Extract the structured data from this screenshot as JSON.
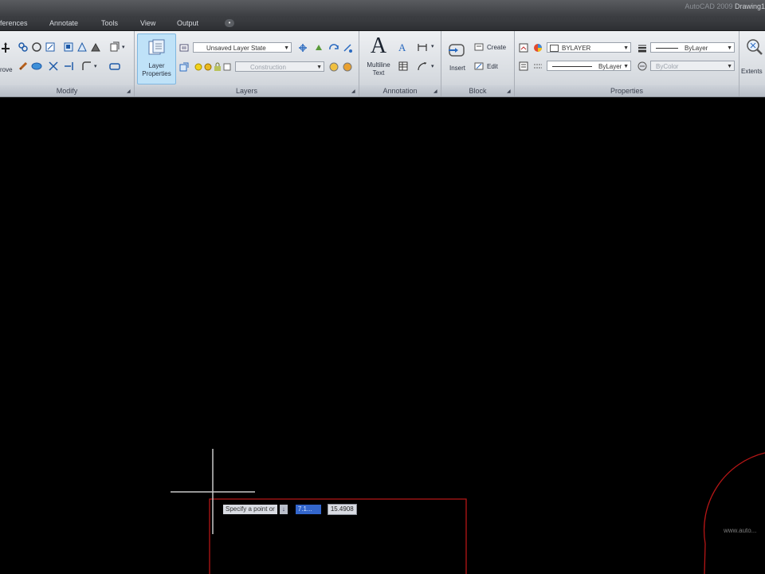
{
  "window": {
    "app_title_prefix": "AutoCAD 2009",
    "app_title_doc": "Drawing1"
  },
  "tabs": [
    "ferences",
    "Annotate",
    "Tools",
    "View",
    "Output"
  ],
  "ribbon": {
    "modify": {
      "label": "Modify",
      "partial_button_label": "rove"
    },
    "layers": {
      "label": "Layers",
      "layer_properties_label": "Layer Properties",
      "layer_state_value": "Unsaved Layer State",
      "current_layer_value": "Construction"
    },
    "annotation": {
      "label": "Annotation",
      "multiline_text_label": "Multiline Text",
      "big_letter": "A"
    },
    "block": {
      "label": "Block",
      "insert_label": "Insert",
      "create_label": "Create",
      "edit_label": "Edit"
    },
    "properties": {
      "label": "Properties",
      "color_value": "BYLAYER",
      "linetype_value": "ByLayer",
      "lineweight_value": "ByLayer",
      "plot_style_value": "ByColor"
    },
    "extents": {
      "label": "Extents"
    }
  },
  "canvas": {
    "dynamic_input": {
      "prompt": "Specify a point or",
      "down_arrow": "↓",
      "selected_value": "7.1...",
      "value": "15.4908"
    },
    "watermark": "www.auto..."
  },
  "colors": {
    "canvas_bg": "#000000",
    "ribbon_bg": "#dfe3e8",
    "selected_tool_bg": "#bfe2f8",
    "crosshair": "#c8c8c8",
    "red_geometry": "#b51616",
    "dyn_selection": "#3366cc"
  }
}
